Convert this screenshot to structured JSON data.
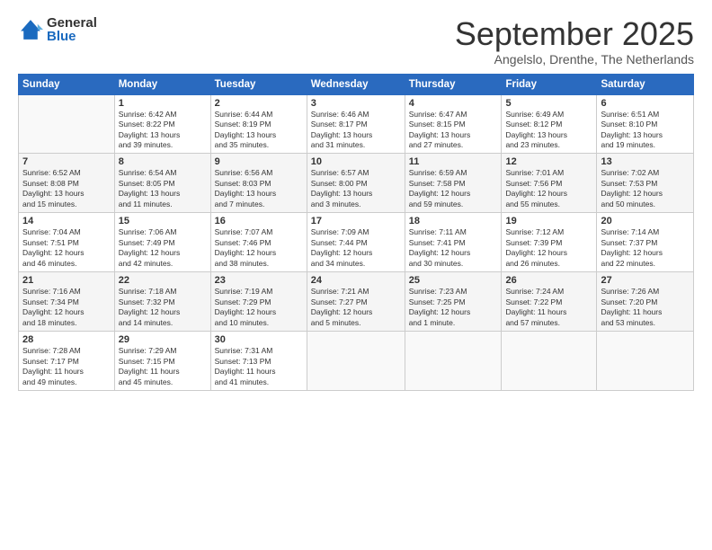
{
  "logo": {
    "general": "General",
    "blue": "Blue"
  },
  "title": "September 2025",
  "subtitle": "Angelslo, Drenthe, The Netherlands",
  "header_days": [
    "Sunday",
    "Monday",
    "Tuesday",
    "Wednesday",
    "Thursday",
    "Friday",
    "Saturday"
  ],
  "weeks": [
    [
      {
        "day": "",
        "info": ""
      },
      {
        "day": "1",
        "info": "Sunrise: 6:42 AM\nSunset: 8:22 PM\nDaylight: 13 hours\nand 39 minutes."
      },
      {
        "day": "2",
        "info": "Sunrise: 6:44 AM\nSunset: 8:19 PM\nDaylight: 13 hours\nand 35 minutes."
      },
      {
        "day": "3",
        "info": "Sunrise: 6:46 AM\nSunset: 8:17 PM\nDaylight: 13 hours\nand 31 minutes."
      },
      {
        "day": "4",
        "info": "Sunrise: 6:47 AM\nSunset: 8:15 PM\nDaylight: 13 hours\nand 27 minutes."
      },
      {
        "day": "5",
        "info": "Sunrise: 6:49 AM\nSunset: 8:12 PM\nDaylight: 13 hours\nand 23 minutes."
      },
      {
        "day": "6",
        "info": "Sunrise: 6:51 AM\nSunset: 8:10 PM\nDaylight: 13 hours\nand 19 minutes."
      }
    ],
    [
      {
        "day": "7",
        "info": "Sunrise: 6:52 AM\nSunset: 8:08 PM\nDaylight: 13 hours\nand 15 minutes."
      },
      {
        "day": "8",
        "info": "Sunrise: 6:54 AM\nSunset: 8:05 PM\nDaylight: 13 hours\nand 11 minutes."
      },
      {
        "day": "9",
        "info": "Sunrise: 6:56 AM\nSunset: 8:03 PM\nDaylight: 13 hours\nand 7 minutes."
      },
      {
        "day": "10",
        "info": "Sunrise: 6:57 AM\nSunset: 8:00 PM\nDaylight: 13 hours\nand 3 minutes."
      },
      {
        "day": "11",
        "info": "Sunrise: 6:59 AM\nSunset: 7:58 PM\nDaylight: 12 hours\nand 59 minutes."
      },
      {
        "day": "12",
        "info": "Sunrise: 7:01 AM\nSunset: 7:56 PM\nDaylight: 12 hours\nand 55 minutes."
      },
      {
        "day": "13",
        "info": "Sunrise: 7:02 AM\nSunset: 7:53 PM\nDaylight: 12 hours\nand 50 minutes."
      }
    ],
    [
      {
        "day": "14",
        "info": "Sunrise: 7:04 AM\nSunset: 7:51 PM\nDaylight: 12 hours\nand 46 minutes."
      },
      {
        "day": "15",
        "info": "Sunrise: 7:06 AM\nSunset: 7:49 PM\nDaylight: 12 hours\nand 42 minutes."
      },
      {
        "day": "16",
        "info": "Sunrise: 7:07 AM\nSunset: 7:46 PM\nDaylight: 12 hours\nand 38 minutes."
      },
      {
        "day": "17",
        "info": "Sunrise: 7:09 AM\nSunset: 7:44 PM\nDaylight: 12 hours\nand 34 minutes."
      },
      {
        "day": "18",
        "info": "Sunrise: 7:11 AM\nSunset: 7:41 PM\nDaylight: 12 hours\nand 30 minutes."
      },
      {
        "day": "19",
        "info": "Sunrise: 7:12 AM\nSunset: 7:39 PM\nDaylight: 12 hours\nand 26 minutes."
      },
      {
        "day": "20",
        "info": "Sunrise: 7:14 AM\nSunset: 7:37 PM\nDaylight: 12 hours\nand 22 minutes."
      }
    ],
    [
      {
        "day": "21",
        "info": "Sunrise: 7:16 AM\nSunset: 7:34 PM\nDaylight: 12 hours\nand 18 minutes."
      },
      {
        "day": "22",
        "info": "Sunrise: 7:18 AM\nSunset: 7:32 PM\nDaylight: 12 hours\nand 14 minutes."
      },
      {
        "day": "23",
        "info": "Sunrise: 7:19 AM\nSunset: 7:29 PM\nDaylight: 12 hours\nand 10 minutes."
      },
      {
        "day": "24",
        "info": "Sunrise: 7:21 AM\nSunset: 7:27 PM\nDaylight: 12 hours\nand 5 minutes."
      },
      {
        "day": "25",
        "info": "Sunrise: 7:23 AM\nSunset: 7:25 PM\nDaylight: 12 hours\nand 1 minute."
      },
      {
        "day": "26",
        "info": "Sunrise: 7:24 AM\nSunset: 7:22 PM\nDaylight: 11 hours\nand 57 minutes."
      },
      {
        "day": "27",
        "info": "Sunrise: 7:26 AM\nSunset: 7:20 PM\nDaylight: 11 hours\nand 53 minutes."
      }
    ],
    [
      {
        "day": "28",
        "info": "Sunrise: 7:28 AM\nSunset: 7:17 PM\nDaylight: 11 hours\nand 49 minutes."
      },
      {
        "day": "29",
        "info": "Sunrise: 7:29 AM\nSunset: 7:15 PM\nDaylight: 11 hours\nand 45 minutes."
      },
      {
        "day": "30",
        "info": "Sunrise: 7:31 AM\nSunset: 7:13 PM\nDaylight: 11 hours\nand 41 minutes."
      },
      {
        "day": "",
        "info": ""
      },
      {
        "day": "",
        "info": ""
      },
      {
        "day": "",
        "info": ""
      },
      {
        "day": "",
        "info": ""
      }
    ]
  ]
}
